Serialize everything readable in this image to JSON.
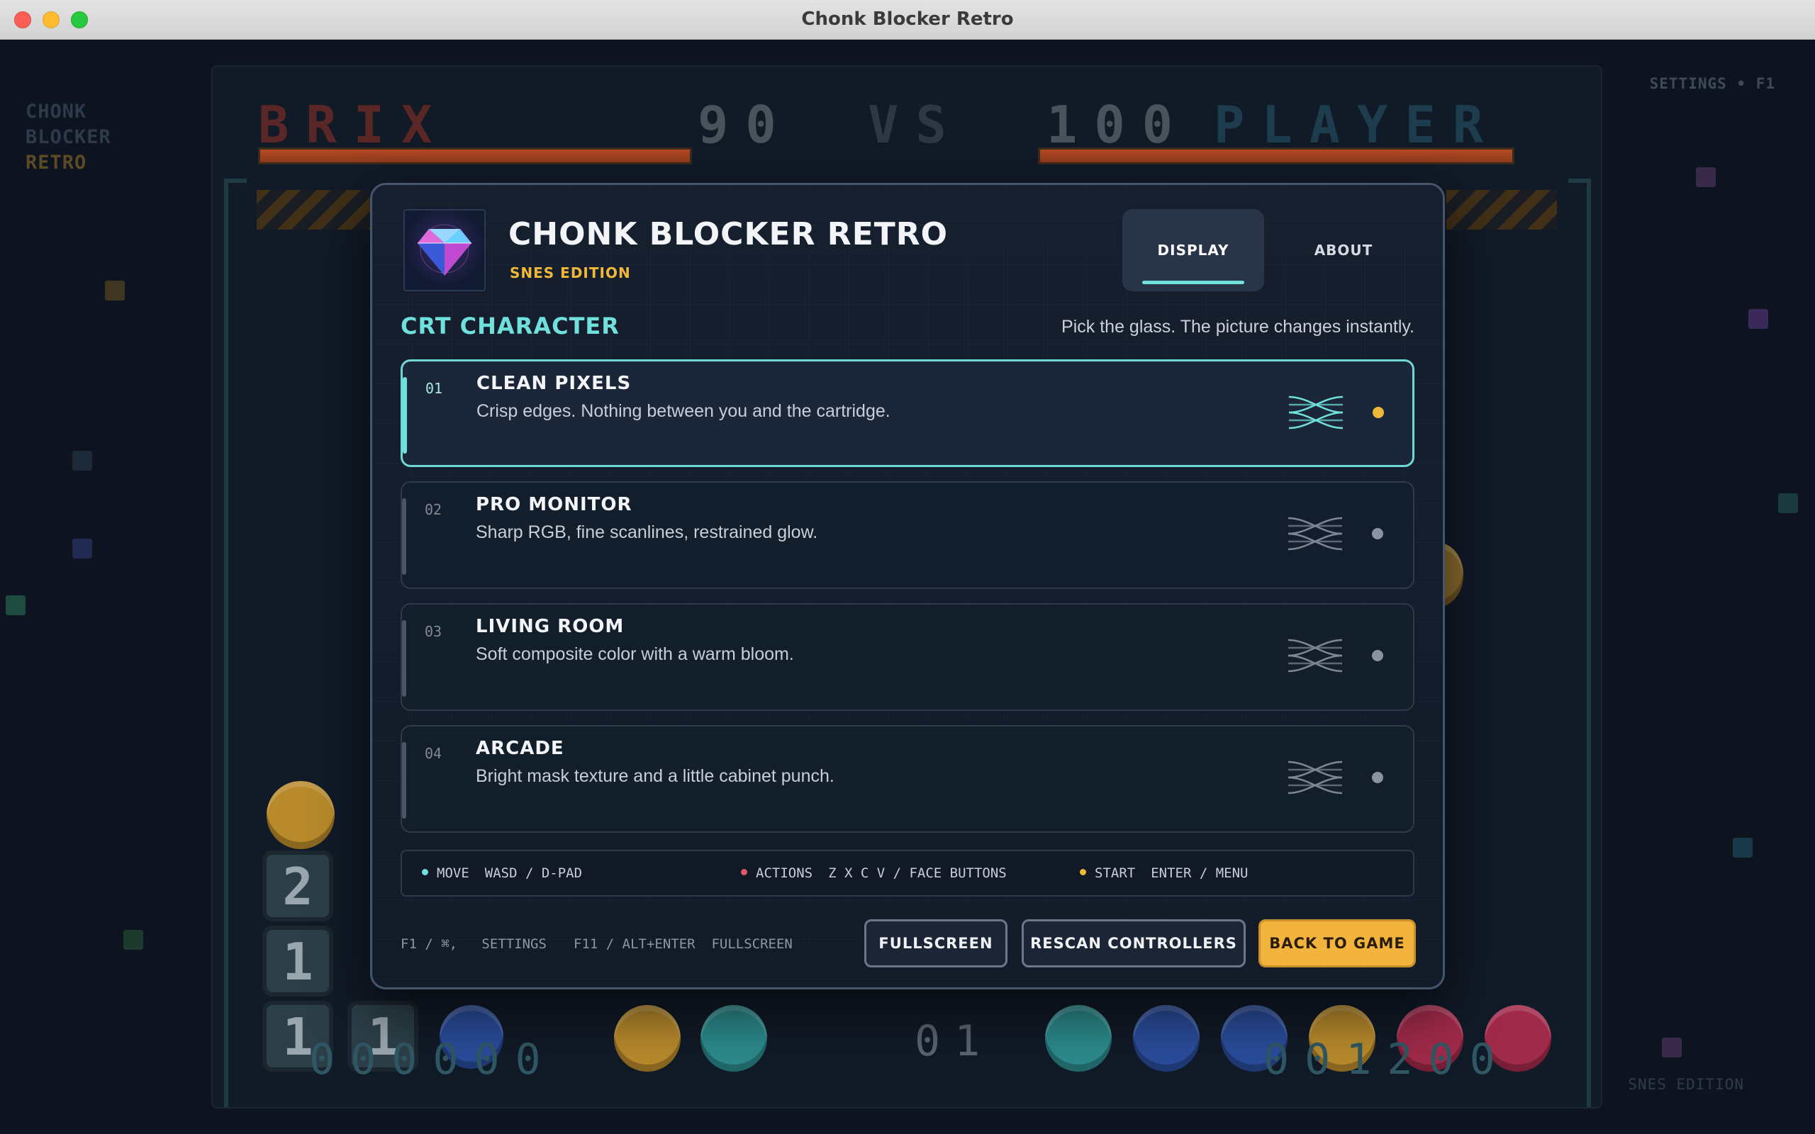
{
  "window": {
    "title": "Chonk Blocker Retro"
  },
  "game": {
    "side_logo": [
      "CHONK",
      "BLOCKER",
      "RETRO"
    ],
    "settings_hint": "SETTINGS • F1",
    "snes_hint": "SNES EDITION",
    "hud": {
      "left_name": "BRIX",
      "left_score": "90",
      "vs": "VS",
      "right_score": "100",
      "right_name": "PLAYER"
    },
    "left_bottom_score": "000000",
    "right_bottom_score": "001200",
    "center_counter": "01",
    "tiles": [
      "2",
      "1",
      "1",
      "1"
    ]
  },
  "modal": {
    "title": "CHONK BLOCKER RETRO",
    "subtitle": "SNES EDITION",
    "tabs": [
      {
        "label": "DISPLAY",
        "active": true
      },
      {
        "label": "ABOUT",
        "active": false
      }
    ],
    "section_title": "CRT CHARACTER",
    "section_hint": "Pick the glass. The picture changes instantly.",
    "options": [
      {
        "num": "01",
        "name": "CLEAN PIXELS",
        "desc": "Crisp edges. Nothing between you and the cartridge.",
        "selected": true
      },
      {
        "num": "02",
        "name": "PRO MONITOR",
        "desc": "Sharp RGB, fine scanlines, restrained glow.",
        "selected": false
      },
      {
        "num": "03",
        "name": "LIVING ROOM",
        "desc": "Soft composite color with a warm bloom.",
        "selected": false
      },
      {
        "num": "04",
        "name": "ARCADE",
        "desc": "Bright mask texture and a little cabinet punch.",
        "selected": false
      }
    ],
    "controls": [
      {
        "label": "MOVE",
        "keys": "WASD / D-PAD",
        "color": "#6fe0dc"
      },
      {
        "label": "ACTIONS",
        "keys": "Z X C V / FACE BUTTONS",
        "color": "#e05a6a"
      },
      {
        "label": "START",
        "keys": "ENTER / MENU",
        "color": "#f0b83a"
      }
    ],
    "footer_hints": [
      {
        "keys": "F1 / ⌘,",
        "label": "SETTINGS"
      },
      {
        "keys": "F11 / ALT+ENTER",
        "label": "FULLSCREEN"
      }
    ],
    "buttons": {
      "fullscreen": "FULLSCREEN",
      "rescan": "RESCAN CONTROLLERS",
      "back": "BACK TO GAME"
    }
  },
  "colors": {
    "accent": "#6fe0dc",
    "gold": "#f2b43c",
    "background": "#0d1420"
  }
}
